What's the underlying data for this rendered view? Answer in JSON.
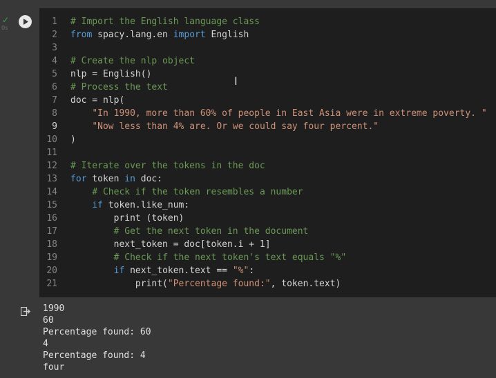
{
  "cell": {
    "status_icon": "check-icon",
    "duration": "0s",
    "run_icon": "play-icon",
    "lines": [
      {
        "n": "1",
        "tokens": [
          {
            "c": "cm",
            "t": "# Import the English language class"
          }
        ]
      },
      {
        "n": "2",
        "tokens": [
          {
            "c": "kw",
            "t": "from"
          },
          {
            "c": "",
            "t": " spacy.lang.en "
          },
          {
            "c": "kw",
            "t": "import"
          },
          {
            "c": "",
            "t": " English"
          }
        ]
      },
      {
        "n": "3",
        "tokens": []
      },
      {
        "n": "4",
        "tokens": [
          {
            "c": "cm",
            "t": "# Create the nlp object"
          }
        ]
      },
      {
        "n": "5",
        "tokens": [
          {
            "c": "",
            "t": "nlp = English()"
          }
        ]
      },
      {
        "n": "6",
        "tokens": [
          {
            "c": "cm",
            "t": "# Process the text"
          }
        ]
      },
      {
        "n": "7",
        "tokens": [
          {
            "c": "",
            "t": "doc = nlp("
          }
        ]
      },
      {
        "n": "8",
        "tokens": [
          {
            "c": "",
            "t": "    "
          },
          {
            "c": "st",
            "t": "\"In 1990, more than 60% of people in East Asia were in extreme poverty. \""
          }
        ]
      },
      {
        "n": "9",
        "tokens": [
          {
            "c": "",
            "t": "    "
          },
          {
            "c": "st",
            "t": "\"Now less than 4% are. Or we could say four percent.\""
          }
        ]
      },
      {
        "n": "10",
        "tokens": [
          {
            "c": "",
            "t": ")"
          }
        ]
      },
      {
        "n": "11",
        "tokens": []
      },
      {
        "n": "12",
        "tokens": [
          {
            "c": "cm",
            "t": "# Iterate over the tokens in the doc"
          }
        ]
      },
      {
        "n": "13",
        "tokens": [
          {
            "c": "kw",
            "t": "for"
          },
          {
            "c": "",
            "t": " token "
          },
          {
            "c": "kw",
            "t": "in"
          },
          {
            "c": "",
            "t": " doc:"
          }
        ]
      },
      {
        "n": "14",
        "tokens": [
          {
            "c": "",
            "t": "    "
          },
          {
            "c": "cm",
            "t": "# Check if the token resembles a number"
          }
        ]
      },
      {
        "n": "15",
        "tokens": [
          {
            "c": "",
            "t": "    "
          },
          {
            "c": "kw",
            "t": "if"
          },
          {
            "c": "",
            "t": " token.like_num:"
          }
        ]
      },
      {
        "n": "16",
        "tokens": [
          {
            "c": "",
            "t": "        print (token)"
          }
        ]
      },
      {
        "n": "17",
        "tokens": [
          {
            "c": "",
            "t": "        "
          },
          {
            "c": "cm",
            "t": "# Get the next token in the document"
          }
        ]
      },
      {
        "n": "18",
        "tokens": [
          {
            "c": "",
            "t": "        next_token = doc[token.i + 1]"
          }
        ]
      },
      {
        "n": "19",
        "tokens": [
          {
            "c": "",
            "t": "        "
          },
          {
            "c": "cm",
            "t": "# Check if the next token's text equals \"%\""
          }
        ]
      },
      {
        "n": "20",
        "tokens": [
          {
            "c": "",
            "t": "        "
          },
          {
            "c": "kw",
            "t": "if"
          },
          {
            "c": "",
            "t": " next_token.text == "
          },
          {
            "c": "st",
            "t": "\"%\""
          },
          {
            "c": "",
            "t": ":"
          }
        ]
      },
      {
        "n": "21",
        "tokens": [
          {
            "c": "",
            "t": "            print("
          },
          {
            "c": "st",
            "t": "\"Percentage found:\""
          },
          {
            "c": "",
            "t": ", token.text)"
          }
        ]
      }
    ],
    "active_line": "9"
  },
  "output": {
    "icon": "output-redirect-icon",
    "lines": [
      "1990",
      "60",
      "Percentage found: 60",
      "4",
      "Percentage found: 4",
      "four"
    ]
  }
}
